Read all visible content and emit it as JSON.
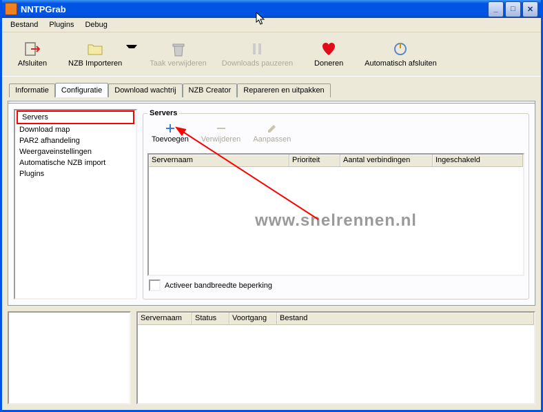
{
  "window": {
    "title": "NNTPGrab"
  },
  "menu": {
    "items": [
      "Bestand",
      "Plugins",
      "Debug"
    ]
  },
  "toolbar": {
    "close": "Afsluiten",
    "import": "NZB Importeren",
    "del_task": "Taak verwijderen",
    "pause": "Downloads pauzeren",
    "donate": "Doneren",
    "auto_close": "Automatisch afsluiten"
  },
  "tabs": {
    "info": "Informatie",
    "config": "Configuratie",
    "queue": "Download wachtrij",
    "creator": "NZB Creator",
    "repair": "Repareren en uitpakken"
  },
  "sidebar": {
    "items": {
      "servers": "Servers",
      "download_map": "Download map",
      "par2": "PAR2 afhandeling",
      "display": "Weergaveinstellingen",
      "autoimport": "Automatische NZB import",
      "plugins": "Plugins"
    }
  },
  "servers": {
    "legend": "Servers",
    "add": "Toevoegen",
    "remove": "Verwijderen",
    "edit": "Aanpassen",
    "cols": {
      "name": "Servernaam",
      "priority": "Prioriteit",
      "connections": "Aantal verbindingen",
      "enabled": "Ingeschakeld"
    },
    "checkbox": "Activeer bandbreedte beperking"
  },
  "bottom": {
    "cols": {
      "name": "Servernaam",
      "status": "Status",
      "progress": "Voortgang",
      "file": "Bestand"
    }
  },
  "watermark": "www.snelrennen.nl"
}
